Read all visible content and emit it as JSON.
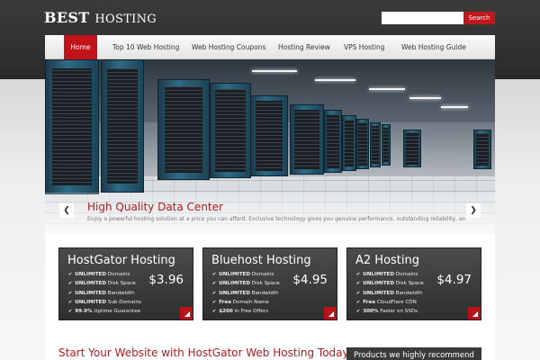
{
  "header": {
    "logo_bold": "BEST",
    "logo_rest": "HOSTING",
    "search_button": "Search"
  },
  "nav": {
    "items": [
      {
        "label": "Home",
        "active": true
      },
      {
        "label": "Top 10 Web Hosting"
      },
      {
        "label": "Web Hosting Coupons"
      },
      {
        "label": "Hosting Review"
      },
      {
        "label": "VPS Hosting"
      },
      {
        "label": "Web Hosting Guide"
      }
    ]
  },
  "slider": {
    "title": "High Quality Data Center",
    "text": "Enjoy a powerful hosting solution at a price you can afford. Exclusive technology gives you genuine performance, outstanding reliability, and advanced functionality.",
    "prev_icon": "chevron-left-icon",
    "next_icon": "chevron-right-icon"
  },
  "cards": [
    {
      "title": "HostGator Hosting",
      "price": "$3.96",
      "features": [
        {
          "strong": "UNLIMITED",
          "rest": "Domains"
        },
        {
          "strong": "UNLIMITED",
          "rest": "Disk Space"
        },
        {
          "strong": "UNLIMITED",
          "rest": "Bandwidth"
        },
        {
          "strong": "UNLIMITED",
          "rest": "Sub Domains"
        },
        {
          "strong": "99.9%",
          "rest": "Uptime Guarantee"
        }
      ]
    },
    {
      "title": "Bluehost Hosting",
      "price": "$4.95",
      "features": [
        {
          "strong": "UNLIMITED",
          "rest": "Domains"
        },
        {
          "strong": "UNLIMITED",
          "rest": "Disk Space"
        },
        {
          "strong": "UNLIMITED",
          "rest": "Bandwidth"
        },
        {
          "strong": "Free",
          "rest": "Domain Name"
        },
        {
          "strong": "$200",
          "rest": "in Free Offers"
        }
      ]
    },
    {
      "title": "A2 Hosting",
      "price": "$4.97",
      "features": [
        {
          "strong": "UNLIMITED",
          "rest": "Domains"
        },
        {
          "strong": "UNLIMITED",
          "rest": "Disk Space"
        },
        {
          "strong": "UNLIMITED",
          "rest": "Bandwidth"
        },
        {
          "strong": "Free",
          "rest": "CloudFlare CDN"
        },
        {
          "strong": "300%",
          "rest": "Faster on SSDs"
        }
      ]
    }
  ],
  "cta": "Start Your Website with HostGator Web Hosting Today!",
  "sidebar_title": "Products we highly recommend",
  "colors": {
    "accent": "#c1141a",
    "dark": "#2f2f2f"
  }
}
